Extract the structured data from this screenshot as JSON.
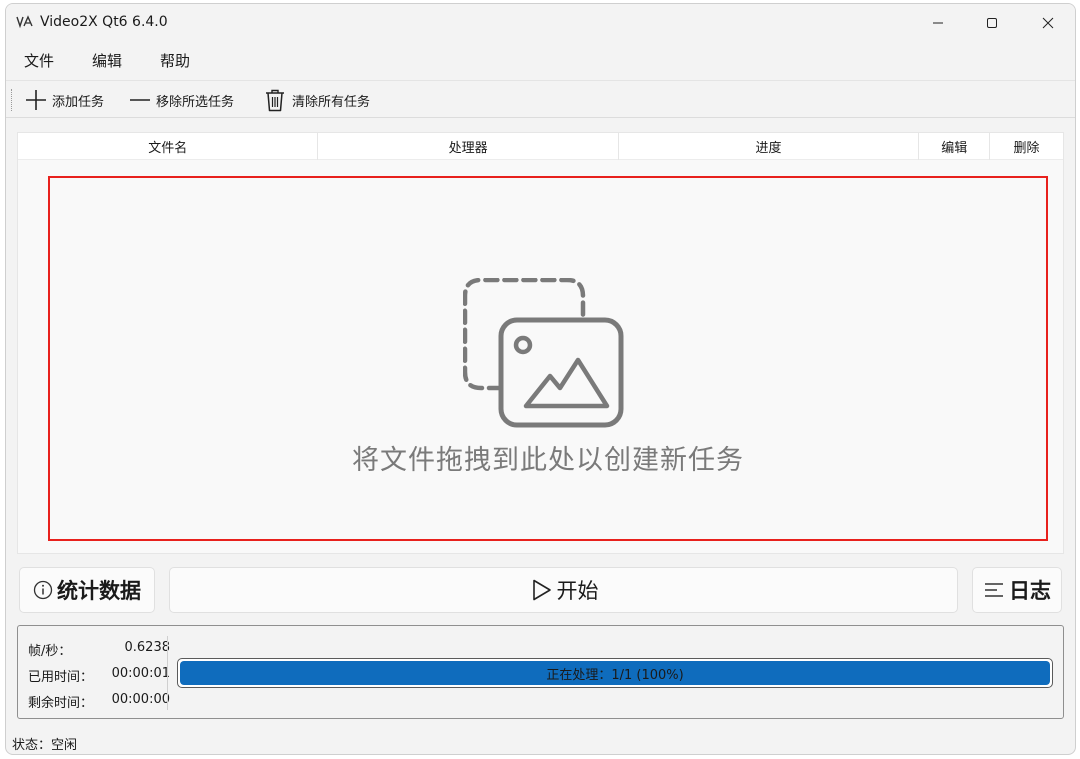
{
  "window": {
    "title": "Video2X Qt6 6.4.0"
  },
  "menu": {
    "items": [
      "文件",
      "编辑",
      "帮助"
    ]
  },
  "toolbar": {
    "add_label": "添加任务",
    "remove_label": "移除所选任务",
    "clear_label": "清除所有任务"
  },
  "table": {
    "columns": [
      "文件名",
      "处理器",
      "进度",
      "编辑",
      "删除"
    ]
  },
  "drop_zone": {
    "text": "将文件拖拽到此处以创建新任务"
  },
  "buttons": {
    "stats_label": "统计数据",
    "start_label": "开始",
    "log_label": "日志"
  },
  "stats": {
    "fps_label": "帧/秒：",
    "fps_value": "0.6238",
    "elapsed_label": "已用时间：",
    "elapsed_value": "00:00:01",
    "remaining_label": "剩余时间：",
    "remaining_value": "00:00:00"
  },
  "progress": {
    "text": "正在处理：1/1 (100%)",
    "fraction": 1.0
  },
  "status": {
    "text": "状态：空闲"
  },
  "colors": {
    "accent": "#0f6cbd",
    "drop_border": "#e8211d"
  }
}
